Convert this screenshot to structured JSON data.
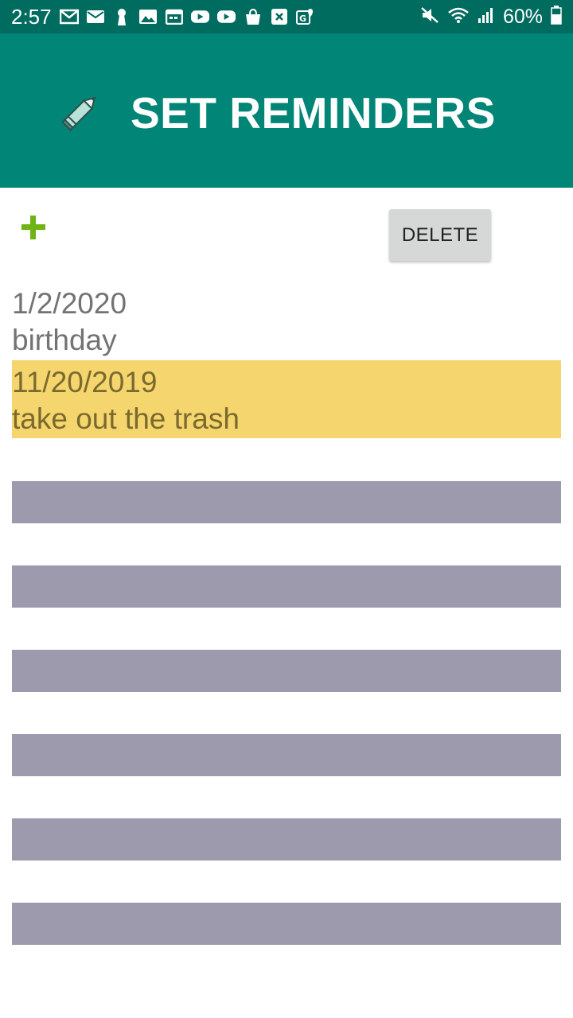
{
  "status_bar": {
    "time": "2:57",
    "battery": "60%",
    "left_icons": [
      "gmail-icon",
      "mail-icon",
      "keyhole-icon",
      "gallery-icon",
      "calendar-icon",
      "youtube-icon",
      "youtube-icon",
      "shopping-bag-icon",
      "close-box-icon",
      "maps-icon"
    ],
    "right_icons": [
      "mute-icon",
      "wifi-icon",
      "signal-icon",
      "battery-icon"
    ]
  },
  "app_bar": {
    "title": "SET REMINDERS",
    "icon": "pencil-icon",
    "color": "#008576"
  },
  "toolbar": {
    "add_icon": "plus-icon",
    "delete_label": "DELETE"
  },
  "reminders": [
    {
      "date": "1/2/2020",
      "text": "birthday",
      "selected": false
    },
    {
      "date": "11/20/2019",
      "text": "take out the trash",
      "selected": true
    }
  ],
  "colors": {
    "status_bar": "#006b5f",
    "selected_row": "#f5d56d",
    "empty_slot": "#9e9aad",
    "add_icon": "#6fb315"
  }
}
